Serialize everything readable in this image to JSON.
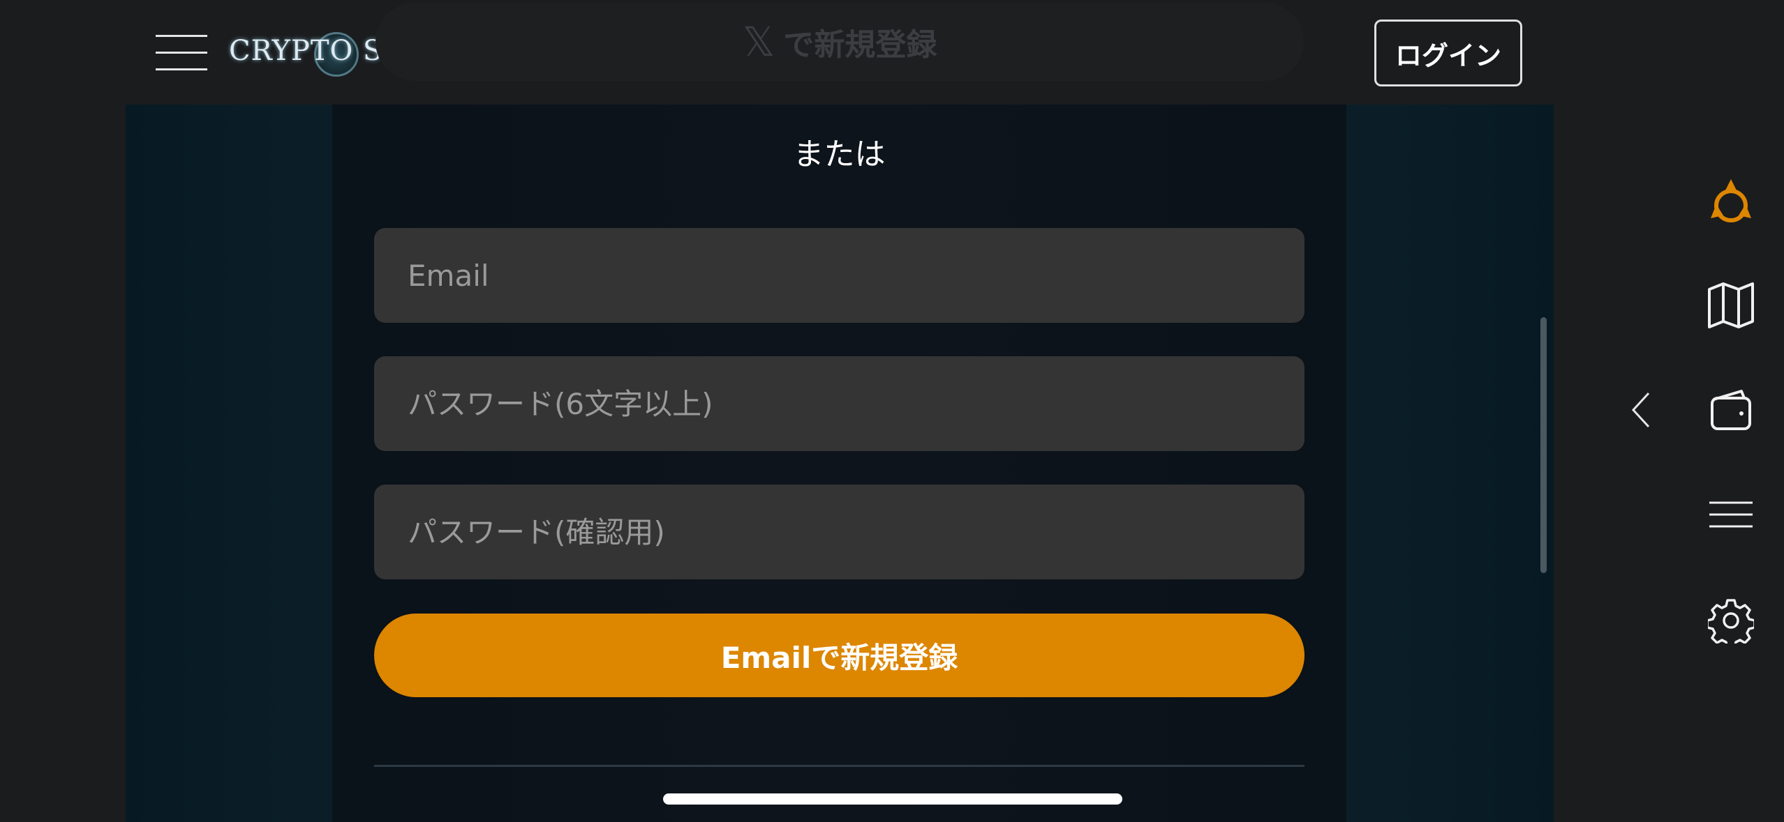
{
  "header": {
    "logo_text": "CRYPTO SPELLS",
    "x_signup_label": "で新規登録",
    "x_icon_glyph": "𝕏",
    "login_label": "ログイン"
  },
  "form": {
    "or_label": "または",
    "email_placeholder": "Email",
    "password_placeholder": "パスワード(6文字以上)",
    "confirm_placeholder": "パスワード(確認用)",
    "email_signup_label": "Emailで新規登録"
  },
  "side_nav": {
    "items": [
      {
        "icon": "spell-orb-icon",
        "color": "#dd8600"
      },
      {
        "icon": "map-icon"
      },
      {
        "icon": "wallet-icon"
      },
      {
        "icon": "menu-lines-icon"
      },
      {
        "icon": "settings-gear-icon"
      }
    ],
    "back_icon": "chevron-left-icon"
  },
  "colors": {
    "accent": "#dd8600",
    "background": "#1b1c1e",
    "field_bg": "#343434"
  }
}
